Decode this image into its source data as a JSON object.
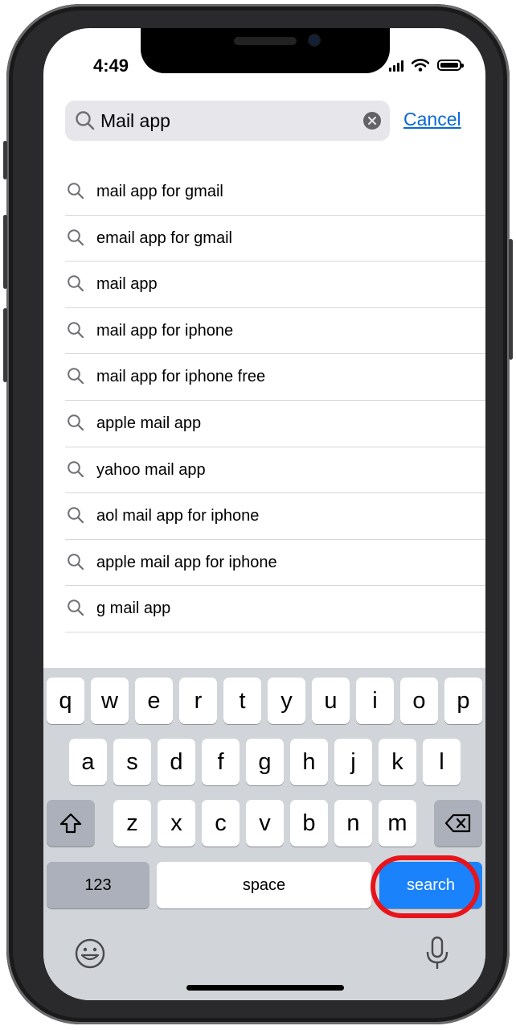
{
  "status_bar": {
    "time": "4:49"
  },
  "search": {
    "value": "Mail app",
    "cancel_label": "Cancel"
  },
  "suggestions": [
    "mail app for gmail",
    "email app for gmail",
    "mail app",
    "mail app for iphone",
    "mail app for iphone free",
    "apple mail app",
    "yahoo mail app",
    "aol mail app for iphone",
    "apple mail app for iphone",
    "g mail app"
  ],
  "keyboard": {
    "row1": [
      "q",
      "w",
      "e",
      "r",
      "t",
      "y",
      "u",
      "i",
      "o",
      "p"
    ],
    "row2": [
      "a",
      "s",
      "d",
      "f",
      "g",
      "h",
      "j",
      "k",
      "l"
    ],
    "row3": [
      "z",
      "x",
      "c",
      "v",
      "b",
      "n",
      "m"
    ],
    "numbers_label": "123",
    "space_label": "space",
    "search_label": "search"
  },
  "icons": {
    "search": "magnifying-glass-icon",
    "clear": "clear-x-icon",
    "shift": "shift-arrow-icon",
    "backspace": "backspace-icon",
    "emoji": "emoji-face-icon",
    "microphone": "microphone-icon"
  },
  "colors": {
    "accent": "#0a68d6",
    "search_key": "#1a82fb",
    "highlight": "#e8141b",
    "keyboard_bg": "#d1d4d9"
  }
}
